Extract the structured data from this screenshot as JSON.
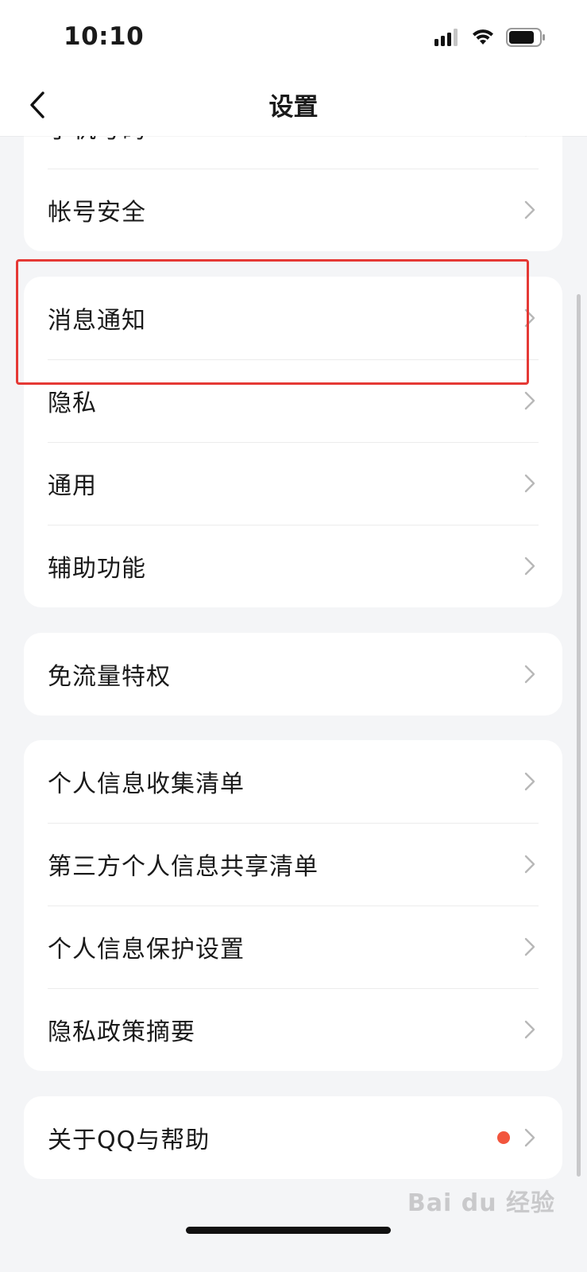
{
  "status_bar": {
    "time": "10:10",
    "icons": [
      "cellular-signal-icon",
      "wifi-icon",
      "battery-icon"
    ]
  },
  "nav": {
    "title": "设置",
    "back_icon": "chevron-left-icon"
  },
  "groups": [
    {
      "items": [
        {
          "label": "手机号码",
          "name": "phone-number"
        },
        {
          "label": "帐号安全",
          "name": "account-security"
        }
      ]
    },
    {
      "items": [
        {
          "label": "消息通知",
          "name": "message-notification"
        },
        {
          "label": "隐私",
          "name": "privacy"
        },
        {
          "label": "通用",
          "name": "general"
        },
        {
          "label": "辅助功能",
          "name": "accessibility"
        }
      ]
    },
    {
      "items": [
        {
          "label": "免流量特权",
          "name": "free-data-privilege"
        }
      ]
    },
    {
      "items": [
        {
          "label": "个人信息收集清单",
          "name": "personal-info-collection-list"
        },
        {
          "label": "第三方个人信息共享清单",
          "name": "third-party-info-sharing-list"
        },
        {
          "label": "个人信息保护设置",
          "name": "personal-info-protection-settings"
        },
        {
          "label": "隐私政策摘要",
          "name": "privacy-policy-summary"
        }
      ]
    },
    {
      "items": [
        {
          "label": "关于QQ与帮助",
          "name": "about-qq-and-help",
          "badge": "red-dot"
        }
      ]
    }
  ],
  "colors": {
    "background": "#f4f5f7",
    "card": "#ffffff",
    "text": "#1a1a1a",
    "chevron": "#b8b8b8",
    "red_dot": "#f2553d",
    "highlight": "#e53935"
  },
  "watermark": {
    "text": "Bai du 经验"
  }
}
